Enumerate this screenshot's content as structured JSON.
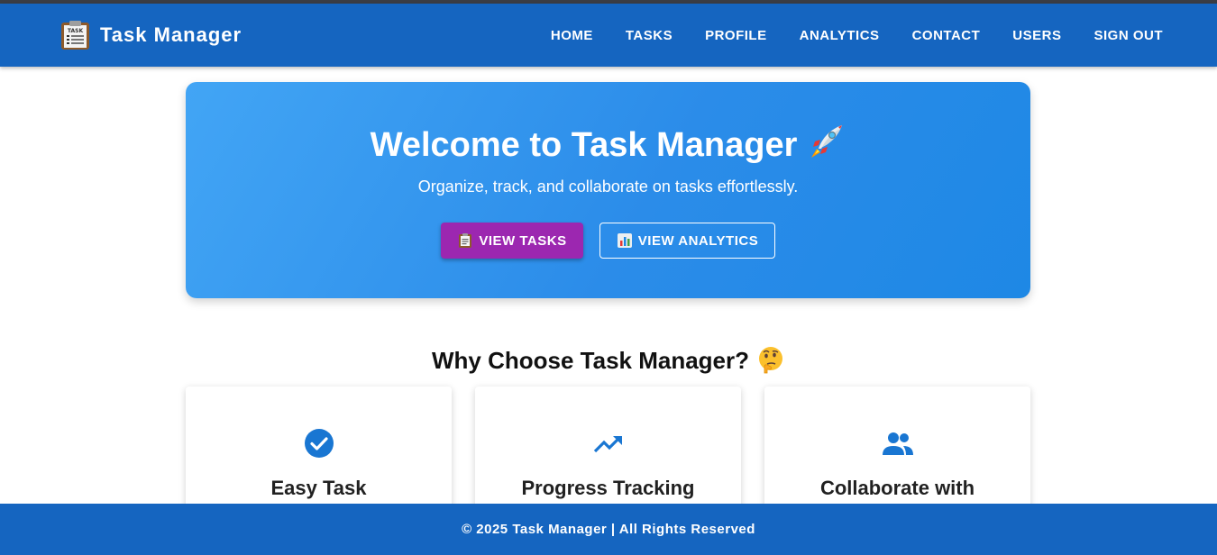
{
  "colors": {
    "navbar": "#1565c0",
    "hero_start": "#42a5f5",
    "hero_end": "#1e88e5",
    "primary_button": "#9c27b0",
    "icon_blue": "#1976d2"
  },
  "navbar": {
    "brand_icon": "clipboard-icon",
    "brand_title": "Task Manager",
    "links": [
      "HOME",
      "TASKS",
      "PROFILE",
      "ANALYTICS",
      "CONTACT",
      "USERS",
      "SIGN OUT"
    ]
  },
  "hero": {
    "title": "Welcome to Task Manager",
    "title_icon": "rocket-icon",
    "subtitle": "Organize, track, and collaborate on tasks effortlessly.",
    "primary_button": {
      "icon": "clipboard-icon",
      "label": "VIEW TASKS"
    },
    "secondary_button": {
      "icon": "bar-chart-icon",
      "label": "VIEW ANALYTICS"
    }
  },
  "features": {
    "title": "Why Choose Task Manager?",
    "title_icon": "thinking-face-icon",
    "cards": [
      {
        "icon": "check-circle-icon",
        "title": "Easy Task"
      },
      {
        "icon": "trending-up-icon",
        "title": "Progress Tracking"
      },
      {
        "icon": "people-icon",
        "title": "Collaborate with"
      }
    ]
  },
  "footer": {
    "text": "© 2025 Task Manager | All Rights Reserved"
  }
}
